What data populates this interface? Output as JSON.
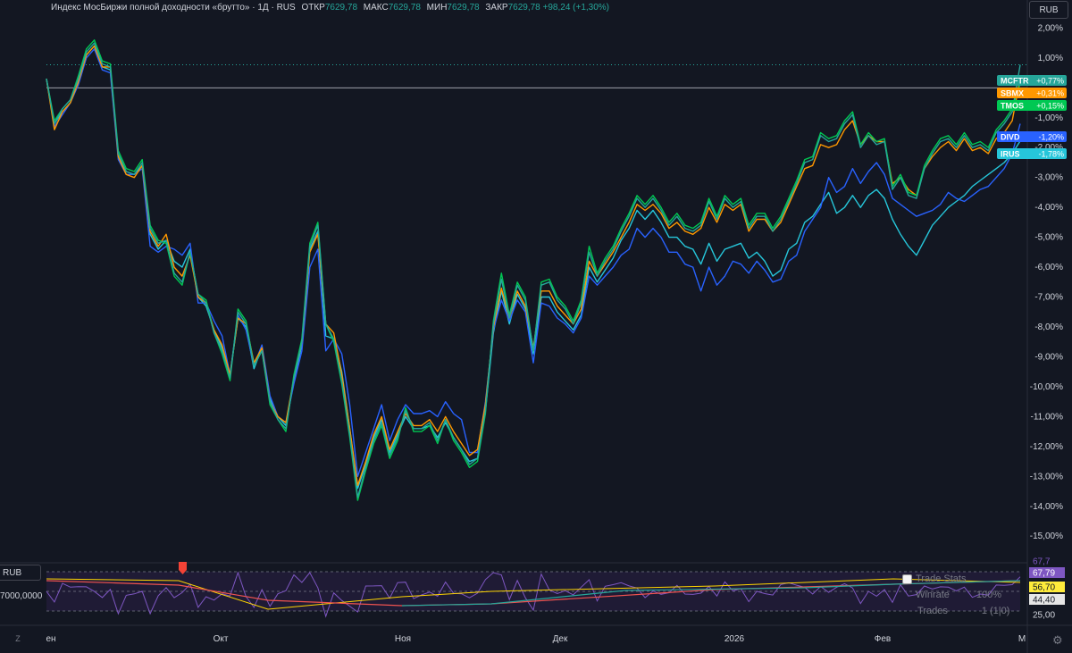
{
  "header": {
    "title": "Индекс МосБиржи полной доходности «брутто» · 1Д · RUS",
    "open_label": "ОТКР",
    "open": "7629,78",
    "high_label": "МАКС",
    "high": "7629,78",
    "low_label": "МИН",
    "low": "7629,78",
    "close_label": "ЗАКР",
    "close": "7629,78",
    "change": "+98,24 (+1,30%)"
  },
  "currency_button": "RUB",
  "oscillator": {
    "currency": "RUB",
    "scale_value": "7000,0000",
    "labels": [
      {
        "text": "67,79",
        "color": "#7e57c2"
      },
      {
        "text": "56,70",
        "color": "#ffeb3b"
      },
      {
        "text": "44,40",
        "color": "#e6e6e6"
      },
      {
        "text": "25,00",
        "color": "#131722"
      }
    ],
    "top_label": "67,7"
  },
  "trade_stats": {
    "title": "Trade Stats",
    "winrate_label": "Winrate",
    "winrate": "100%",
    "trades_label": "Trades",
    "trades": "1 (1|0)"
  },
  "z_button": "Z",
  "chart_data": {
    "type": "line",
    "x_labels": [
      "ен",
      "Окт",
      "Ноя",
      "Дек",
      "2026",
      "Фев",
      "М"
    ],
    "y_ticks": [
      "2,00%",
      "1,00%",
      "-1,00%",
      "-2,00%",
      "-3,00%",
      "-4,00%",
      "-5,00%",
      "-6,00%",
      "-7,00%",
      "-8,00%",
      "-9,00%",
      "-10,00%",
      "-11,00%",
      "-12,00%",
      "-13,00%",
      "-14,00%",
      "-15,00%"
    ],
    "ylim": [
      -15.8,
      2.4
    ],
    "series": [
      {
        "name": "MCFTR",
        "color": "#26a69a",
        "last": "+0,77%",
        "values": [
          0.3,
          -1.2,
          -0.7,
          -0.4,
          0.3,
          1.2,
          1.5,
          0.8,
          0.7,
          -2.2,
          -2.8,
          -2.9,
          -2.5,
          -4.7,
          -5.2,
          -5.1,
          -6.2,
          -6.5,
          -5.5,
          -6.9,
          -7.2,
          -8.2,
          -8.8,
          -9.7,
          -7.5,
          -7.9,
          -9.3,
          -8.8,
          -10.5,
          -11.1,
          -11.4,
          -9.7,
          -8.5,
          -5.3,
          -4.6,
          -7.9,
          -8.4,
          -9.8,
          -11.6,
          -13.7,
          -12.7,
          -11.8,
          -11.2,
          -12.3,
          -11.7,
          -10.8,
          -11.4,
          -11.4,
          -11.2,
          -11.8,
          -11.1,
          -11.7,
          -12.1,
          -12.6,
          -12.4,
          -10.8,
          -7.9,
          -6.4,
          -7.7,
          -6.6,
          -7.1,
          -8.8,
          -6.6,
          -6.5,
          -7.1,
          -7.4,
          -7.9,
          -7.2,
          -5.5,
          -6.3,
          -5.8,
          -5.4,
          -4.8,
          -4.3,
          -3.7,
          -4.0,
          -3.7,
          -4.1,
          -4.6,
          -4.3,
          -4.7,
          -4.8,
          -4.6,
          -3.8,
          -4.4,
          -3.7,
          -4.0,
          -3.8,
          -4.7,
          -4.3,
          -4.3,
          -4.8,
          -4.4,
          -3.8,
          -3.2,
          -2.5,
          -2.4,
          -1.6,
          -1.8,
          -1.7,
          -1.2,
          -0.9,
          -2.0,
          -1.6,
          -1.9,
          -1.8,
          -3.4,
          -3.0,
          -3.6,
          -3.7,
          -2.7,
          -2.2,
          -1.8,
          -1.7,
          -2.0,
          -1.6,
          -2.0,
          -1.9,
          -2.1,
          -1.5,
          -1.2,
          -0.8,
          0.77
        ]
      },
      {
        "name": "SBMX",
        "color": "#ff9800",
        "last": "+0,31%",
        "values": [
          0.3,
          -1.4,
          -0.8,
          -0.5,
          0.2,
          1.1,
          1.4,
          0.7,
          0.7,
          -2.3,
          -2.9,
          -3.0,
          -2.6,
          -4.8,
          -5.3,
          -4.9,
          -6.0,
          -6.3,
          -5.6,
          -7.0,
          -7.2,
          -8.1,
          -8.6,
          -9.6,
          -7.7,
          -7.9,
          -9.2,
          -8.7,
          -10.5,
          -11.0,
          -11.2,
          -9.7,
          -8.5,
          -5.5,
          -4.9,
          -7.9,
          -8.2,
          -9.6,
          -11.4,
          -13.3,
          -12.5,
          -11.6,
          -11.0,
          -12.1,
          -11.5,
          -10.9,
          -11.3,
          -11.3,
          -11.1,
          -11.5,
          -11.0,
          -11.5,
          -11.9,
          -12.3,
          -12.1,
          -10.6,
          -8.0,
          -6.7,
          -7.7,
          -6.8,
          -7.3,
          -8.7,
          -6.8,
          -6.8,
          -7.3,
          -7.6,
          -7.9,
          -7.4,
          -5.8,
          -6.3,
          -5.9,
          -5.5,
          -5.0,
          -4.5,
          -3.9,
          -4.1,
          -3.9,
          -4.2,
          -4.7,
          -4.5,
          -4.8,
          -4.9,
          -4.7,
          -4.0,
          -4.5,
          -3.9,
          -4.1,
          -3.9,
          -4.8,
          -4.4,
          -4.4,
          -4.8,
          -4.5,
          -3.9,
          -3.3,
          -2.7,
          -2.6,
          -1.9,
          -2.0,
          -1.9,
          -1.4,
          -1.1,
          -1.9,
          -1.6,
          -1.8,
          -1.8,
          -3.2,
          -3.0,
          -3.4,
          -3.6,
          -2.7,
          -2.3,
          -2.0,
          -1.8,
          -2.1,
          -1.7,
          -2.1,
          -2.0,
          -2.2,
          -1.7,
          -1.5,
          -1.1,
          0.31
        ]
      },
      {
        "name": "TMOS",
        "color": "#00c853",
        "last": "+0,15%",
        "values": [
          0.3,
          -1.1,
          -0.7,
          -0.4,
          0.4,
          1.3,
          1.6,
          0.9,
          0.8,
          -2.1,
          -2.7,
          -2.8,
          -2.4,
          -4.6,
          -5.1,
          -5.2,
          -6.3,
          -6.6,
          -5.5,
          -6.9,
          -7.1,
          -8.2,
          -8.9,
          -9.8,
          -7.4,
          -7.8,
          -9.3,
          -8.8,
          -10.6,
          -11.1,
          -11.5,
          -9.6,
          -8.4,
          -5.2,
          -4.5,
          -7.9,
          -8.5,
          -9.9,
          -11.7,
          -13.8,
          -12.8,
          -11.9,
          -11.3,
          -12.4,
          -11.8,
          -10.7,
          -11.5,
          -11.5,
          -11.3,
          -11.9,
          -11.1,
          -11.8,
          -12.2,
          -12.7,
          -12.5,
          -10.9,
          -7.8,
          -6.2,
          -7.6,
          -6.5,
          -7.0,
          -8.8,
          -6.5,
          -6.4,
          -7.0,
          -7.3,
          -7.8,
          -7.1,
          -5.3,
          -6.2,
          -5.7,
          -5.3,
          -4.7,
          -4.2,
          -3.6,
          -3.9,
          -3.6,
          -4.0,
          -4.5,
          -4.2,
          -4.6,
          -4.7,
          -4.5,
          -3.7,
          -4.3,
          -3.6,
          -3.9,
          -3.7,
          -4.6,
          -4.2,
          -4.2,
          -4.7,
          -4.3,
          -3.7,
          -3.1,
          -2.4,
          -2.3,
          -1.5,
          -1.7,
          -1.6,
          -1.1,
          -0.8,
          -1.9,
          -1.5,
          -1.8,
          -1.7,
          -3.3,
          -2.9,
          -3.5,
          -3.6,
          -2.6,
          -2.1,
          -1.7,
          -1.6,
          -1.9,
          -1.5,
          -1.9,
          -1.8,
          -2.0,
          -1.4,
          -1.1,
          -0.7,
          0.15
        ]
      },
      {
        "name": "DIVD",
        "color": "#2962ff",
        "last": "-1,20%",
        "values": [
          0.3,
          -1.3,
          -0.9,
          -0.5,
          0.1,
          1.0,
          1.3,
          0.6,
          0.5,
          -2.4,
          -2.9,
          -2.9,
          -2.7,
          -5.3,
          -5.5,
          -5.3,
          -5.4,
          -5.6,
          -5.2,
          -7.2,
          -7.2,
          -7.8,
          -8.3,
          -9.6,
          -7.6,
          -8.1,
          -9.3,
          -8.6,
          -10.3,
          -11.0,
          -11.2,
          -9.9,
          -8.8,
          -6.0,
          -5.4,
          -8.8,
          -8.4,
          -8.9,
          -10.6,
          -13.0,
          -12.2,
          -11.4,
          -10.6,
          -11.8,
          -11.1,
          -10.6,
          -10.9,
          -10.9,
          -10.8,
          -11.0,
          -10.5,
          -10.9,
          -11.1,
          -12.2,
          -12.2,
          -10.5,
          -8.1,
          -7.1,
          -7.8,
          -7.1,
          -7.5,
          -9.2,
          -7.2,
          -7.3,
          -7.7,
          -7.9,
          -8.2,
          -7.7,
          -6.3,
          -6.6,
          -6.3,
          -6.0,
          -5.6,
          -5.4,
          -4.7,
          -5.0,
          -4.7,
          -5.0,
          -5.5,
          -5.5,
          -5.9,
          -6.0,
          -6.8,
          -6.0,
          -6.6,
          -6.3,
          -5.8,
          -5.9,
          -6.2,
          -5.8,
          -6.1,
          -6.5,
          -6.4,
          -5.8,
          -5.6,
          -4.8,
          -4.4,
          -4.0,
          -3.0,
          -3.5,
          -3.3,
          -2.7,
          -3.2,
          -2.8,
          -2.5,
          -2.9,
          -3.7,
          -3.9,
          -4.1,
          -4.3,
          -4.2,
          -4.1,
          -3.9,
          -3.5,
          -3.7,
          -3.8,
          -3.6,
          -3.4,
          -3.3,
          -3.0,
          -2.7,
          -2.2,
          -1.2
        ]
      },
      {
        "name": "IRUS",
        "color": "#26c6da",
        "last": "-1,78%",
        "values": [
          0.3,
          -1.2,
          -0.8,
          -0.5,
          0.2,
          1.1,
          1.4,
          0.7,
          0.6,
          -2.3,
          -2.8,
          -2.9,
          -2.6,
          -4.9,
          -5.4,
          -5.1,
          -5.8,
          -6.0,
          -5.4,
          -7.0,
          -7.3,
          -8.1,
          -8.7,
          -9.6,
          -7.7,
          -8.0,
          -9.4,
          -8.7,
          -10.4,
          -11.0,
          -11.3,
          -9.8,
          -8.6,
          -5.4,
          -4.8,
          -8.3,
          -8.4,
          -9.5,
          -11.4,
          -13.4,
          -12.6,
          -11.7,
          -11.1,
          -12.2,
          -11.6,
          -11.0,
          -11.4,
          -11.4,
          -11.3,
          -11.7,
          -11.2,
          -11.7,
          -12.1,
          -12.5,
          -12.4,
          -10.8,
          -8.2,
          -6.8,
          -7.9,
          -6.9,
          -7.4,
          -8.9,
          -7.0,
          -7.0,
          -7.5,
          -7.8,
          -8.1,
          -7.6,
          -6.0,
          -6.5,
          -6.1,
          -5.7,
          -5.1,
          -4.7,
          -4.1,
          -4.4,
          -4.1,
          -4.5,
          -5.0,
          -5.0,
          -5.3,
          -5.4,
          -5.9,
          -5.2,
          -5.8,
          -5.4,
          -5.3,
          -5.2,
          -5.7,
          -5.5,
          -5.8,
          -6.3,
          -6.1,
          -5.4,
          -5.2,
          -4.5,
          -4.3,
          -3.9,
          -3.5,
          -4.2,
          -4.0,
          -3.6,
          -4.0,
          -3.6,
          -3.4,
          -3.7,
          -4.4,
          -4.9,
          -5.3,
          -5.6,
          -5.1,
          -4.6,
          -4.3,
          -4.0,
          -3.8,
          -3.6,
          -3.3,
          -3.1,
          -2.9,
          -2.7,
          -2.5,
          -2.2,
          -1.78
        ]
      }
    ],
    "reference_lines": [
      0.77,
      0
    ]
  }
}
